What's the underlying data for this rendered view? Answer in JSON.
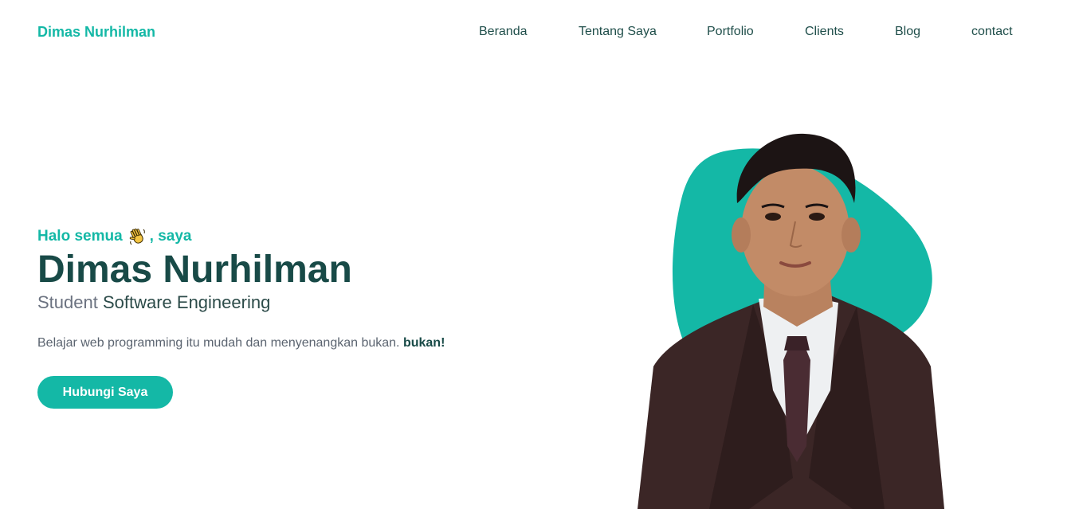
{
  "brand": {
    "name": "Dimas Nurhilman",
    "accent": "#14b8a6"
  },
  "nav": {
    "items": [
      {
        "label": "Beranda"
      },
      {
        "label": "Tentang Saya"
      },
      {
        "label": "Portfolio"
      },
      {
        "label": "Clients"
      },
      {
        "label": "Blog"
      },
      {
        "label": "contact"
      }
    ]
  },
  "hero": {
    "greeting_pre": "Halo semua",
    "greeting_icon": "waving-hand-icon",
    "greeting_post": ", saya",
    "name": "Dimas Nurhilman",
    "subtitle_muted": "Student",
    "subtitle_strong": "Software Engineering",
    "tagline_text": "Belajar web programming itu mudah dan menyenangkan bukan.",
    "tagline_bold": "bukan!",
    "cta_label": "Hubungi Saya",
    "photo": "portrait-photo",
    "blob_color": "#14b8a6"
  }
}
